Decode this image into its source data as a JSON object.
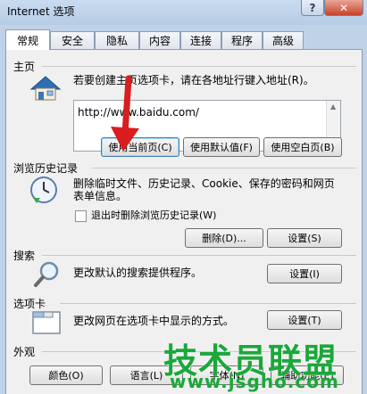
{
  "window": {
    "title": "Internet 选项",
    "help_label": "?",
    "close_label": "✕"
  },
  "tabs": [
    "常规",
    "安全",
    "隐私",
    "内容",
    "连接",
    "程序",
    "高级"
  ],
  "homepage": {
    "section_title": "主页",
    "description": "若要创建主页选项卡，请在各地址行键入地址(R)。",
    "url_value": "http://www.baidu.com/",
    "buttons": [
      "使用当前页(C)",
      "使用默认值(F)",
      "使用空白页(B)"
    ]
  },
  "history": {
    "section_title": "浏览历史记录",
    "description_line1": "删除临时文件、历史记录、Cookie、保存的密码和网页",
    "description_line2": "表单信息。",
    "checkbox_label": "退出时删除浏览历史记录(W)",
    "delete_button": "删除(D)...",
    "settings_button": "设置(S)"
  },
  "search": {
    "section_title": "搜索",
    "description": "更改默认的搜索提供程序。",
    "settings_button": "设置(I)"
  },
  "tabs_section": {
    "section_title": "选项卡",
    "description": "更改网页在选项卡中显示的方式。",
    "settings_button": "设置(T)"
  },
  "appearance": {
    "section_title": "外观",
    "buttons": [
      "颜色(O)",
      "语言(L)",
      "字体(N)",
      "辅助功能(E)"
    ]
  },
  "watermark": {
    "text": "技术员联盟",
    "url": "www.jsgho.com"
  },
  "colors": {
    "accent": "#3c7fb1",
    "watermark": "#1aa83a",
    "arrow": "#d81e1e"
  }
}
